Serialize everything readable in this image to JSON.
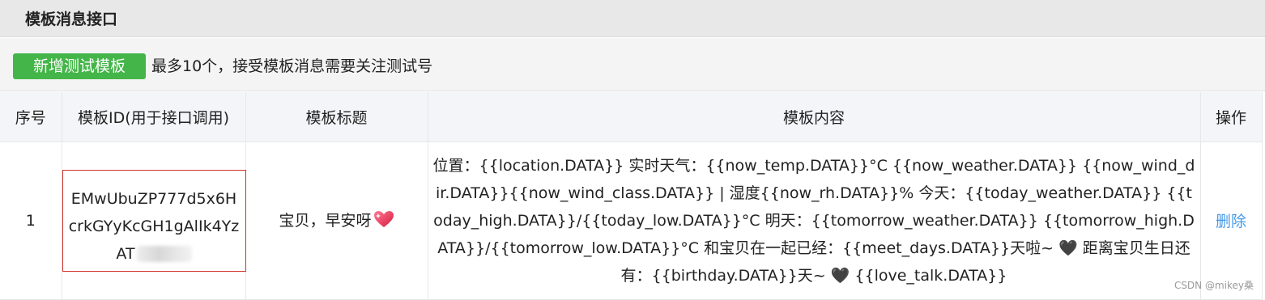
{
  "header": {
    "title": "模板消息接口"
  },
  "toolbar": {
    "add_button": "新增测试模板",
    "hint": "最多10个，接受模板消息需要关注测试号"
  },
  "table": {
    "columns": [
      "序号",
      "模板ID(用于接口调用)",
      "模板标题",
      "模板内容",
      "操作"
    ],
    "rows": [
      {
        "index": "1",
        "template_id_lines": [
          "EMwUbuZP777d5x6H",
          "crkGYyKcGH1gAlIk4Yz",
          "AT"
        ],
        "title": "宝贝，早安呀",
        "content": "位置：{{location.DATA}} 实时天气：{{now_temp.DATA}}°C {{now_weather.DATA}} {{now_wind_dir.DATA}}{{now_wind_class.DATA}} | 湿度{{now_rh.DATA}}% 今天：{{today_weather.DATA}} {{today_high.DATA}}/{{today_low.DATA}}°C 明天：{{tomorrow_weather.DATA}} {{tomorrow_high.DATA}}/{{tomorrow_low.DATA}}°C 和宝贝在一起已经：{{meet_days.DATA}}天啦~ 🖤 距离宝贝生日还有：{{birthday.DATA}}天~ 🖤 {{love_talk.DATA}}",
        "action": "删除"
      }
    ]
  },
  "watermark": "CSDN @mikey桑",
  "colors": {
    "accent_green": "#44b549",
    "link_blue": "#459ae9",
    "highlight_red": "#d0302a"
  }
}
